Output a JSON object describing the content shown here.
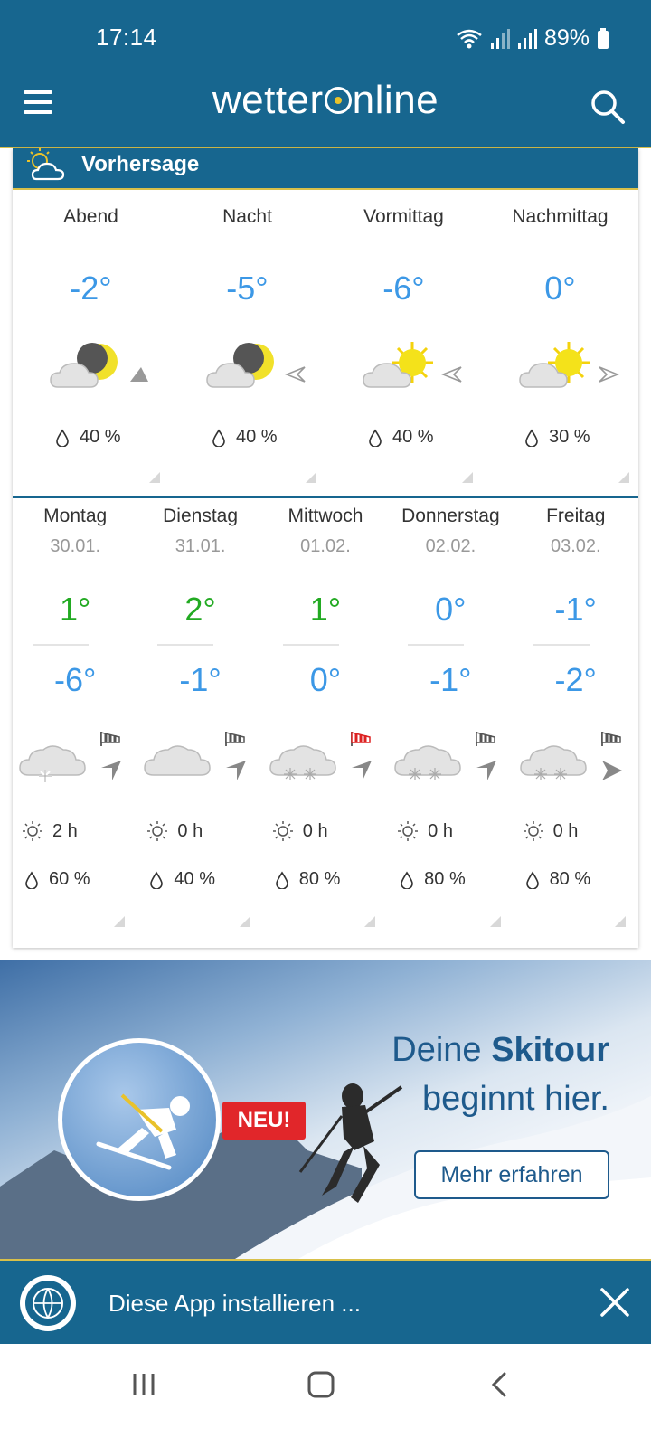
{
  "status_bar": {
    "time": "17:14",
    "battery": "89%"
  },
  "header": {
    "logo_left": "wetter",
    "logo_right": "nline"
  },
  "forecast": {
    "title": "Vorhersage",
    "periods": [
      {
        "label": "Abend",
        "temp": "-2°",
        "rain": "40 %",
        "icon": "moon-cloud-icon"
      },
      {
        "label": "Nacht",
        "temp": "-5°",
        "rain": "40 %",
        "icon": "moon-cloud-icon"
      },
      {
        "label": "Vormittag",
        "temp": "-6°",
        "rain": "40 %",
        "icon": "sun-cloud-icon"
      },
      {
        "label": "Nachmittag",
        "temp": "0°",
        "rain": "30 %",
        "icon": "sun-cloud-icon"
      }
    ],
    "days": [
      {
        "name": "Montag",
        "date": "30.01.",
        "max": "1°",
        "min": "-6°",
        "sun": "2 h",
        "rain": "60 %",
        "icon": "snow-cloud-icon"
      },
      {
        "name": "Dienstag",
        "date": "31.01.",
        "max": "2°",
        "min": "-1°",
        "sun": "0 h",
        "rain": "40 %",
        "icon": "cloud-icon"
      },
      {
        "name": "Mittwoch",
        "date": "01.02.",
        "max": "1°",
        "min": "0°",
        "sun": "0 h",
        "rain": "80 %",
        "icon": "snow-cloud-icon"
      },
      {
        "name": "Donnerstag",
        "date": "02.02.",
        "max": "0°",
        "min": "-1°",
        "sun": "0 h",
        "rain": "80 %",
        "icon": "snow-cloud-icon"
      },
      {
        "name": "Freitag",
        "date": "03.02.",
        "max": "-1°",
        "min": "-2°",
        "sun": "0 h",
        "rain": "80 %",
        "icon": "snow-cloud-icon"
      }
    ]
  },
  "colors": {
    "primary": "#17668f",
    "accent": "#d8c04a",
    "cold_temp": "#3c98e6",
    "warm_temp": "#22aa22"
  },
  "ad": {
    "badge": "NEU!",
    "line1_prefix": "Deine ",
    "line1_bold": "Skitour",
    "line2": "beginnt hier.",
    "button": "Mehr erfahren"
  },
  "install_banner": {
    "text": "Diese App installieren ..."
  }
}
